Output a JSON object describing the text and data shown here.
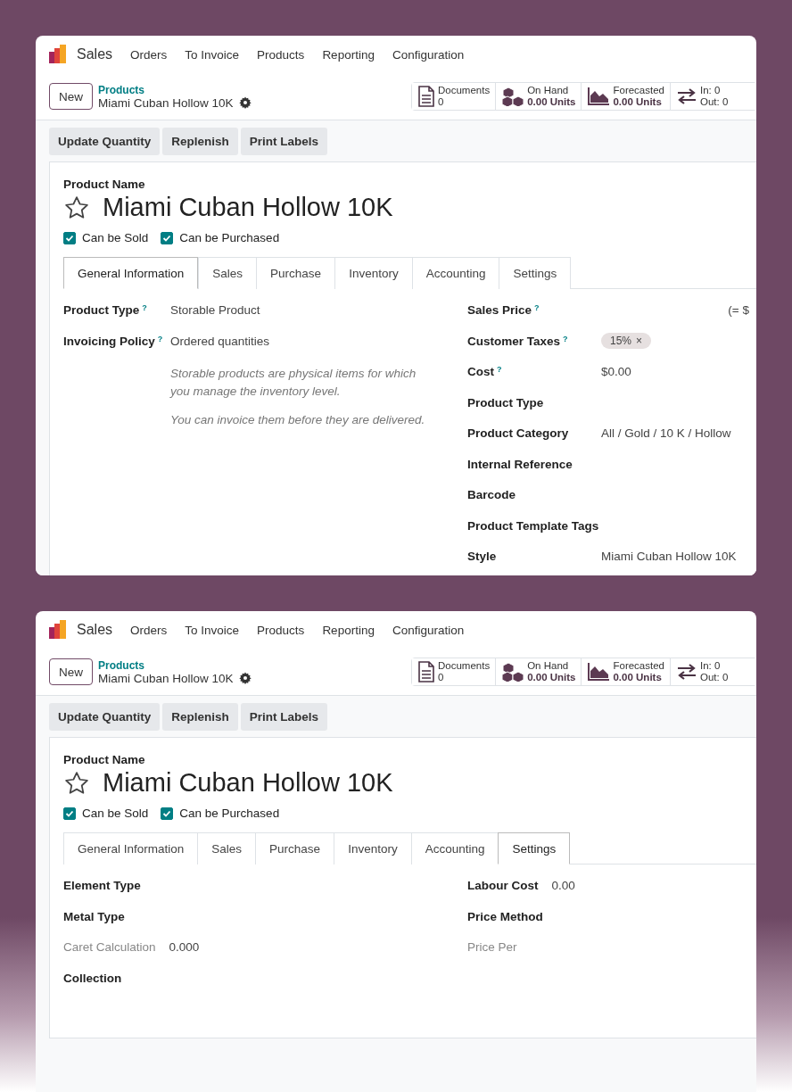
{
  "panels": [
    {
      "app": {
        "name": "Sales"
      },
      "menu": [
        "Orders",
        "To Invoice",
        "Products",
        "Reporting",
        "Configuration"
      ],
      "new_button": "New",
      "breadcrumb": {
        "parent": "Products",
        "current": "Miami Cuban Hollow 10K"
      },
      "stats": [
        {
          "kind": "documents",
          "label": "Documents",
          "value": "0"
        },
        {
          "kind": "on_hand",
          "label": "On Hand",
          "value": "0.00 Units"
        },
        {
          "kind": "forecast",
          "label": "Forecasted",
          "value": "0.00 Units"
        },
        {
          "kind": "moves",
          "label": "In: 0",
          "value": "Out: 0"
        }
      ],
      "actions": [
        "Update Quantity",
        "Replenish",
        "Print Labels"
      ],
      "product": {
        "name_label": "Product Name",
        "name": "Miami Cuban Hollow 10K",
        "checkboxes": [
          {
            "label": "Can be Sold",
            "checked": true
          },
          {
            "label": "Can be Purchased",
            "checked": true
          }
        ]
      },
      "tabs": [
        {
          "label": "General Information",
          "selected": true
        },
        {
          "label": "Sales",
          "selected": false
        },
        {
          "label": "Purchase",
          "selected": false
        },
        {
          "label": "Inventory",
          "selected": false
        },
        {
          "label": "Accounting",
          "selected": false
        },
        {
          "label": "Settings",
          "selected": false
        }
      ],
      "content": {
        "kind": "aligned",
        "left": [
          {
            "kind": "text",
            "label": "Product Type",
            "help": "?",
            "value": "Storable Product"
          },
          {
            "kind": "text",
            "label": "Invoicing Policy",
            "help": "?",
            "value": "Ordered quantities"
          },
          {
            "kind": "note",
            "text": "Storable products are physical items for which you manage the inventory level."
          },
          {
            "kind": "note",
            "text": "You can invoice them before they are delivered."
          }
        ],
        "right": [
          {
            "kind": "trailing",
            "label": "Sales Price",
            "help": "?",
            "value": "(= $"
          },
          {
            "kind": "tag",
            "label": "Customer Taxes",
            "help": "?",
            "value": "15%",
            "remove": "×"
          },
          {
            "kind": "text",
            "label": "Cost",
            "help": "?",
            "value": "$0.00"
          },
          {
            "kind": "text",
            "label": "Product Type"
          },
          {
            "kind": "text",
            "label": "Product Category",
            "value": "All / Gold / 10 K / Hollow"
          },
          {
            "kind": "text",
            "label": "Internal Reference"
          },
          {
            "kind": "text",
            "label": "Barcode"
          },
          {
            "kind": "text",
            "label": "Product Template Tags"
          },
          {
            "kind": "text",
            "label": "Style",
            "value": "Miami Cuban Hollow 10K"
          }
        ]
      }
    },
    {
      "app": {
        "name": "Sales"
      },
      "menu": [
        "Orders",
        "To Invoice",
        "Products",
        "Reporting",
        "Configuration"
      ],
      "new_button": "New",
      "breadcrumb": {
        "parent": "Products",
        "current": "Miami Cuban Hollow 10K"
      },
      "stats": [
        {
          "kind": "documents",
          "label": "Documents",
          "value": "0"
        },
        {
          "kind": "on_hand",
          "label": "On Hand",
          "value": "0.00 Units"
        },
        {
          "kind": "forecast",
          "label": "Forecasted",
          "value": "0.00 Units"
        },
        {
          "kind": "moves",
          "label": "In: 0",
          "value": "Out: 0"
        }
      ],
      "actions": [
        "Update Quantity",
        "Replenish",
        "Print Labels"
      ],
      "product": {
        "name_label": "Product Name",
        "name": "Miami Cuban Hollow 10K",
        "checkboxes": [
          {
            "label": "Can be Sold",
            "checked": true
          },
          {
            "label": "Can be Purchased",
            "checked": true
          }
        ]
      },
      "tabs": [
        {
          "label": "General Information",
          "selected": false
        },
        {
          "label": "Sales",
          "selected": false
        },
        {
          "label": "Purchase",
          "selected": false
        },
        {
          "label": "Inventory",
          "selected": false
        },
        {
          "label": "Accounting",
          "selected": false
        },
        {
          "label": "Settings",
          "selected": true
        }
      ],
      "content": {
        "kind": "inline",
        "left": [
          {
            "kind": "text",
            "label": "Element Type",
            "muted": false
          },
          {
            "kind": "text",
            "label": "Metal Type",
            "muted": false
          },
          {
            "kind": "text",
            "label": "Caret Calculation",
            "value": "0.000",
            "muted": true
          },
          {
            "kind": "text",
            "label": "Collection",
            "muted": false
          }
        ],
        "right": [
          {
            "kind": "text",
            "label": "Labour Cost",
            "value": "0.00",
            "muted": false
          },
          {
            "kind": "text",
            "label": "Price Method",
            "muted": false
          },
          {
            "kind": "text",
            "label": "Price Per",
            "muted": true
          }
        ]
      }
    }
  ]
}
